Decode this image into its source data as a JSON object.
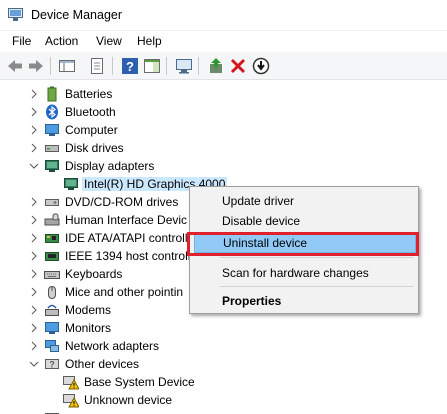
{
  "window": {
    "title": "Device Manager"
  },
  "menu": [
    "File",
    "Action",
    "View",
    "Help"
  ],
  "tree": [
    {
      "label": "Batteries",
      "icon": "battery-icon",
      "expanded": false
    },
    {
      "label": "Bluetooth",
      "icon": "bluetooth-icon",
      "expanded": false
    },
    {
      "label": "Computer",
      "icon": "computer-icon",
      "expanded": false
    },
    {
      "label": "Disk drives",
      "icon": "disk-drive-icon",
      "expanded": false
    },
    {
      "label": "Display adapters",
      "icon": "display-adapter-icon",
      "expanded": true
    },
    {
      "label": "Intel(R) HD Graphics 4000",
      "icon": "display-adapter-icon",
      "child": true,
      "selected": true
    },
    {
      "label": "DVD/CD-ROM drives",
      "icon": "dvd-drive-icon",
      "expanded": false
    },
    {
      "label": "Human Interface Devic",
      "icon": "hid-icon",
      "expanded": false
    },
    {
      "label": "IDE ATA/ATAPI controll",
      "icon": "ide-controller-icon",
      "expanded": false
    },
    {
      "label": "IEEE 1394 host controlle",
      "icon": "ieee1394-icon",
      "expanded": false
    },
    {
      "label": "Keyboards",
      "icon": "keyboard-icon",
      "expanded": false
    },
    {
      "label": "Mice and other pointin",
      "icon": "mouse-icon",
      "expanded": false
    },
    {
      "label": "Modems",
      "icon": "modem-icon",
      "expanded": false
    },
    {
      "label": "Monitors",
      "icon": "monitor-icon",
      "expanded": false
    },
    {
      "label": "Network adapters",
      "icon": "network-adapter-icon",
      "expanded": false
    },
    {
      "label": "Other devices",
      "icon": "other-devices-icon",
      "expanded": true
    },
    {
      "label": "Base System Device",
      "icon": "warning-device-icon",
      "child": true
    },
    {
      "label": "Unknown device",
      "icon": "warning-device-icon",
      "child": true
    }
  ],
  "context_menu": {
    "update": "Update driver",
    "disable": "Disable device",
    "uninstall": "Uninstall device",
    "scan": "Scan for hardware changes",
    "properties": "Properties"
  },
  "colors": {
    "highlight": "#91c9f7",
    "selection": "#cce8ff",
    "annotation_box": "#e0202a"
  }
}
